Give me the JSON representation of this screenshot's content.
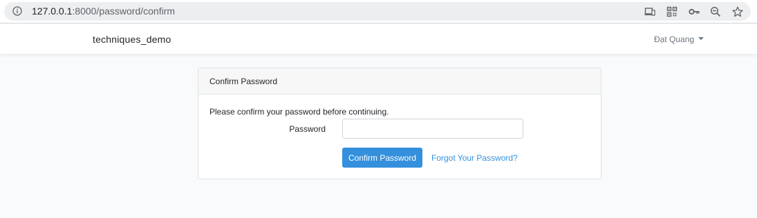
{
  "browser": {
    "url_host": "127.0.0.1",
    "url_rest": ":8000/password/confirm"
  },
  "navbar": {
    "brand": "techniques_demo",
    "user_name": "Đạt Quang"
  },
  "card": {
    "header": "Confirm Password",
    "message": "Please confirm your password before continuing.",
    "password_label": "Password",
    "password_value": "",
    "confirm_button": "Confirm Password",
    "forgot_link": "Forgot Your Password?"
  },
  "colors": {
    "primary": "#3490dc",
    "background": "#f8fafc"
  }
}
